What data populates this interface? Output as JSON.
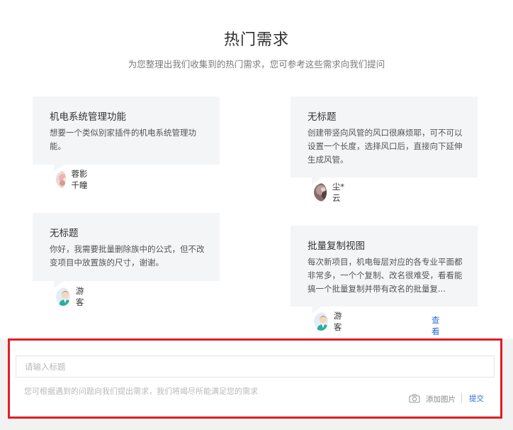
{
  "header": {
    "title": "热门需求",
    "subtitle": "为您整理出我们收集到的热门需求，您可参考这些需求向我们提问"
  },
  "cards": [
    {
      "title": "机电系统管理功能",
      "desc": "想要一个类似别家插件的机电系统管理功能。",
      "author": "蓉影千瞳",
      "avatar": "photo-avatar"
    },
    {
      "title": "无标题",
      "desc": "创建带竖向风管的风口很麻烦耶，可不可以设置一个长度，选择风口后，直接向下延伸生成风管。",
      "author": "尘*云",
      "avatar": "photo-avatar"
    },
    {
      "title": "无标题",
      "desc": "你好，我需要批量删除族中的公式，但不改变项目中放置族的尺寸，谢谢。",
      "author": "游客",
      "avatar": "guest-avatar"
    },
    {
      "title": "批量复制视图",
      "desc": "每次新项目，机电每层对应的各专业平面都非常多，一个个复制、改名很难受，看看能搞一个批量复制并带有改名的批量复...",
      "author": "游客",
      "avatar": "guest-avatar"
    }
  ],
  "view_all": "查看全部",
  "form": {
    "title_placeholder": "请输入标题",
    "content_placeholder": "您可根据遇到的问题向我们提出需求，我们将竭尽所能满足您的需求",
    "add_image": "添加图片",
    "submit": "提交"
  },
  "colors": {
    "accent": "#2b6fd6",
    "highlight_border": "#e51c23",
    "card_bg": "#f4f5f7"
  }
}
